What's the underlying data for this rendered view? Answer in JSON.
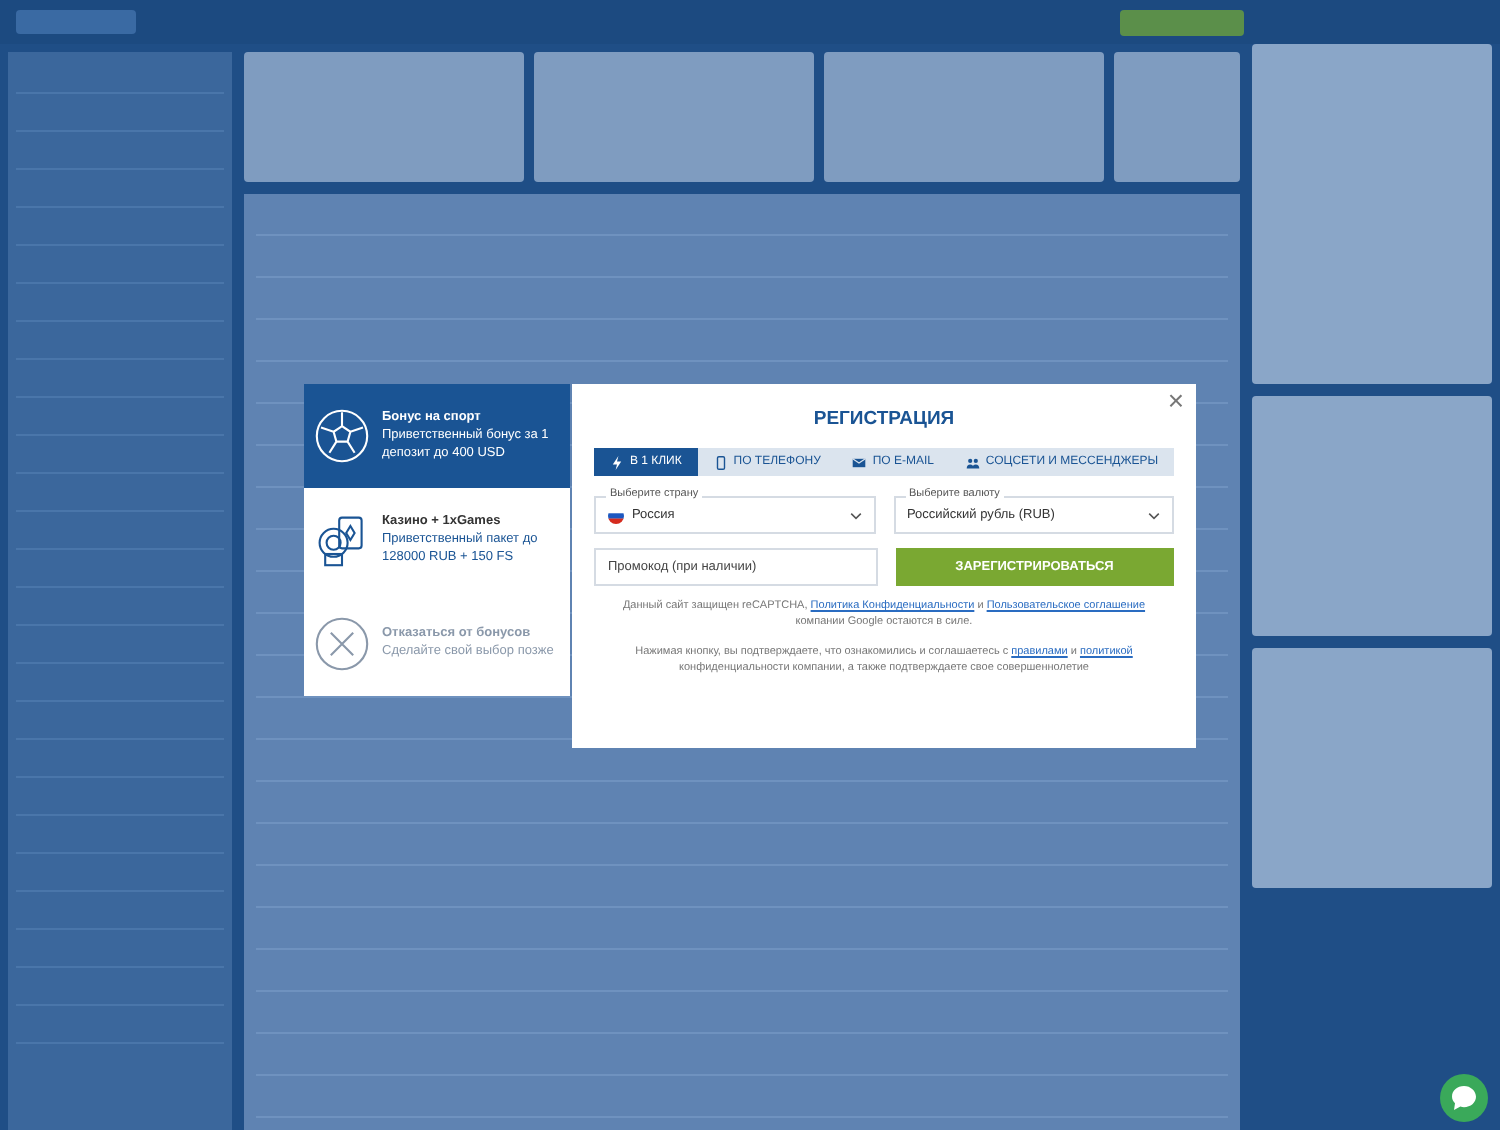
{
  "bonuses": [
    {
      "kind": "sport",
      "title": "Бонус на спорт",
      "text": "Приветственный бонус за 1 депозит до 400 USD",
      "selected": true
    },
    {
      "kind": "casino",
      "title": "Казино + 1xGames",
      "text": "Приветственный пакет до 128000 RUB + 150 FS",
      "selected": false
    },
    {
      "kind": "decline",
      "title": "Отказаться от бонусов",
      "text": "Сделайте свой выбор позже",
      "selected": false
    }
  ],
  "modal": {
    "close": "×",
    "title": "РЕГИСТРАЦИЯ",
    "tabs": [
      {
        "kind": "bolt",
        "label": "В 1 КЛИК",
        "selected": true
      },
      {
        "kind": "phone",
        "label": "ПО ТЕЛЕФОНУ",
        "selected": false
      },
      {
        "kind": "mail",
        "label": "ПО E-MAIL",
        "selected": false
      },
      {
        "kind": "people",
        "label": "СОЦСЕТИ И МЕССЕНДЖЕРЫ",
        "selected": false
      }
    ],
    "country": {
      "label": "Выберите страну",
      "value": "Россия"
    },
    "currency": {
      "label": "Выберите валюту",
      "value": "Российский рубль (RUB)"
    },
    "promo": {
      "placeholder": "Промокод (при наличии)"
    },
    "submit": "ЗАРЕГИСТРИРОВАТЬСЯ",
    "captcha": [
      {
        "text": "Данный сайт защищен reCAPTCHA, ",
        "link": false
      },
      {
        "text": "Политика Конфиденциальности",
        "link": true
      },
      {
        "text": " и ",
        "link": false
      },
      {
        "text": "Пользовательское соглашение",
        "link": true
      },
      {
        "text": " компании Google остаются в силе.",
        "link": false
      }
    ],
    "agreement": [
      {
        "text": "Нажимая кнопку, вы подтверждаете, что ознакомились и соглашаетесь с ",
        "link": false
      },
      {
        "text": "правилами",
        "link": true
      },
      {
        "text": " и ",
        "link": false
      },
      {
        "text": "политикой",
        "link": true
      },
      {
        "text": " конфиденциальности компании, а также подтверждаете свое совершеннолетие",
        "link": false
      }
    ]
  }
}
